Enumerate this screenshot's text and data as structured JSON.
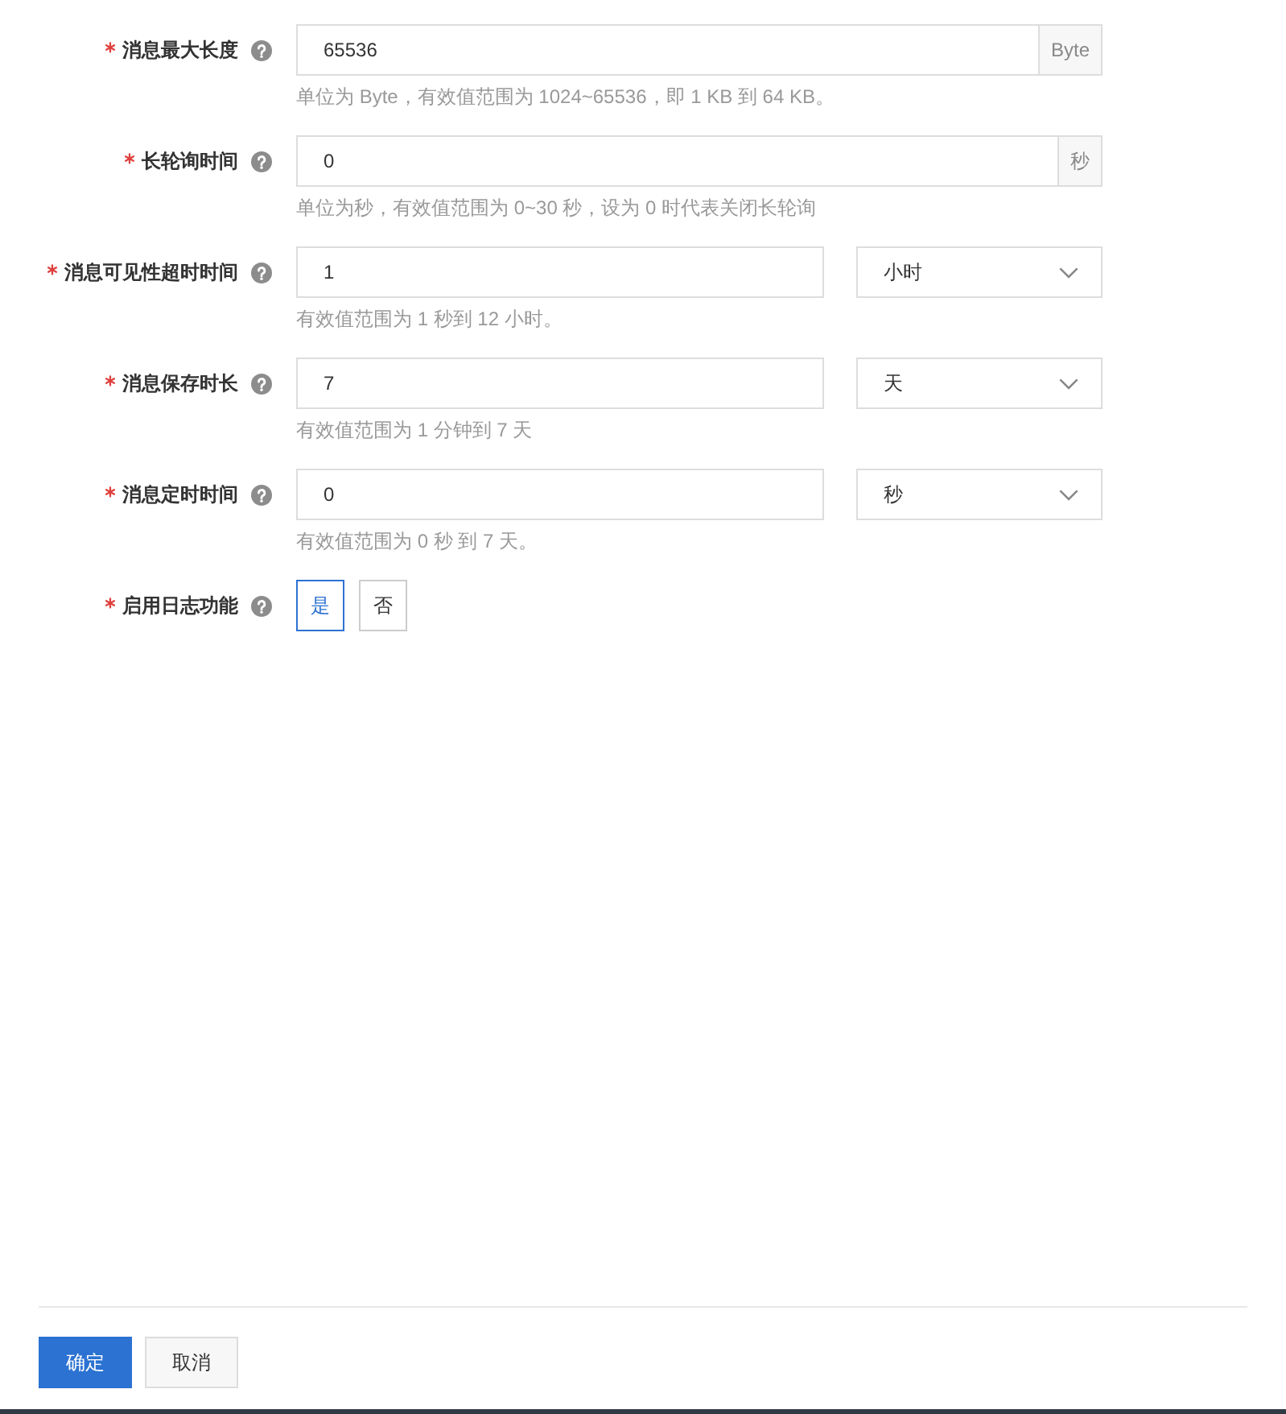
{
  "form": {
    "fields": [
      {
        "kind": "addon",
        "label": "消息最大长度",
        "required": true,
        "value": "65536",
        "addon": "Byte",
        "hint": "单位为 Byte，有效值范围为 1024~65536，即 1 KB 到 64 KB。"
      },
      {
        "kind": "addon",
        "label": "长轮询时间",
        "required": true,
        "value": "0",
        "addon": "秒",
        "hint": "单位为秒，有效值范围为 0~30 秒，设为 0 时代表关闭长轮询"
      },
      {
        "kind": "select",
        "label": "消息可见性超时时间",
        "required": true,
        "value": "1",
        "unit": "小时",
        "hint": "有效值范围为 1 秒到 12 小时。"
      },
      {
        "kind": "select",
        "label": "消息保存时长",
        "required": true,
        "value": "7",
        "unit": "天",
        "hint": "有效值范围为 1 分钟到 7 天"
      },
      {
        "kind": "select",
        "label": "消息定时时间",
        "required": true,
        "value": "0",
        "unit": "秒",
        "hint": "有效值范围为 0 秒 到 7 天。"
      },
      {
        "kind": "choice",
        "label": "启用日志功能",
        "required": true,
        "options": [
          {
            "label": "是",
            "selected": true
          },
          {
            "label": "否",
            "selected": false
          }
        ]
      }
    ]
  },
  "buttons": [
    {
      "label": "确定",
      "kind": "primary"
    },
    {
      "label": "取消",
      "kind": "default"
    }
  ]
}
